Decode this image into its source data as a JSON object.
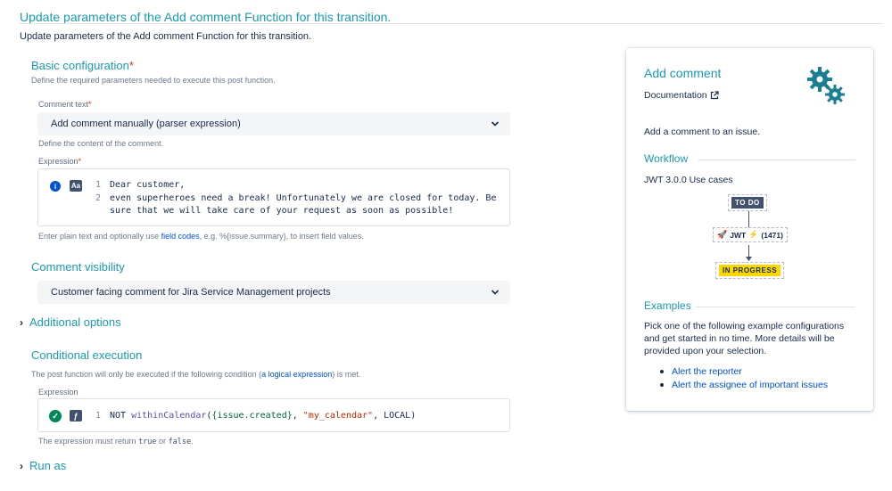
{
  "page": {
    "title": "Update parameters of the Add comment Function for this transition.",
    "description": "Update parameters of the Add comment Function for this transition."
  },
  "basic": {
    "title": "Basic configuration",
    "required_mark": "*",
    "help": "Define the required parameters needed to execute this post function.",
    "comment_text_label": "Comment text",
    "comment_text_value": "Add comment manually (parser expression)",
    "comment_text_help": "Define the content of the comment.",
    "expression_label": "Expression",
    "expression_lines": [
      {
        "num": "1",
        "text": "Dear customer,"
      },
      {
        "num": "2",
        "text": "even superheroes need a break! Unfortunately we are closed for today. Be"
      },
      {
        "num": "",
        "text": "sure that we will take care of your request as soon as possible!"
      }
    ],
    "footer_pre": "Enter plain text and optionally use ",
    "footer_link": "field codes",
    "footer_post": ", e.g. %{issue.summary}, to insert field values."
  },
  "visibility": {
    "title": "Comment visibility",
    "value": "Customer facing comment for Jira Service Management projects"
  },
  "additional": {
    "title": "Additional options",
    "caret": "›"
  },
  "conditional": {
    "title": "Conditional execution",
    "help_pre": "The post function will only be executed if the following condition (",
    "help_link": "a logical expression",
    "help_post": ") is met.",
    "expression_label": "Expression",
    "line_num": "1",
    "code": {
      "kw": "NOT",
      "fn": "withinCalendar",
      "open": "(",
      "field": "{issue.created}",
      "comma1": ", ",
      "str": "\"my_calendar\"",
      "rest": ", LOCAL)"
    },
    "footer_pre": "The expression must return ",
    "footer_true": "true",
    "footer_or": " or ",
    "footer_false": "false",
    "footer_end": "."
  },
  "run_as": {
    "title": "Run as",
    "caret": "›"
  },
  "sidebar": {
    "title": "Add comment",
    "documentation": "Documentation",
    "description": "Add a comment to an issue.",
    "workflow_title": "Workflow",
    "workflow_caption": "JWT 3.0.0 Use cases",
    "status_from": "TO DO",
    "transition_label": "JWT",
    "transition_count": "(1471)",
    "status_to": "IN PROGRESS",
    "examples_title": "Examples",
    "examples_text": "Pick one of the following example configurations and get started in no time. More details will be provided upon your selection.",
    "examples": [
      {
        "label": "Alert the reporter"
      },
      {
        "label": "Alert the assignee of important issues"
      }
    ]
  },
  "colors": {
    "accent": "#1a9aae",
    "link": "#0052cc",
    "todo_bg": "#42526e",
    "inprogress_bg": "#ffd700",
    "valid_green": "#00875a",
    "info_blue": "#0052cc"
  }
}
